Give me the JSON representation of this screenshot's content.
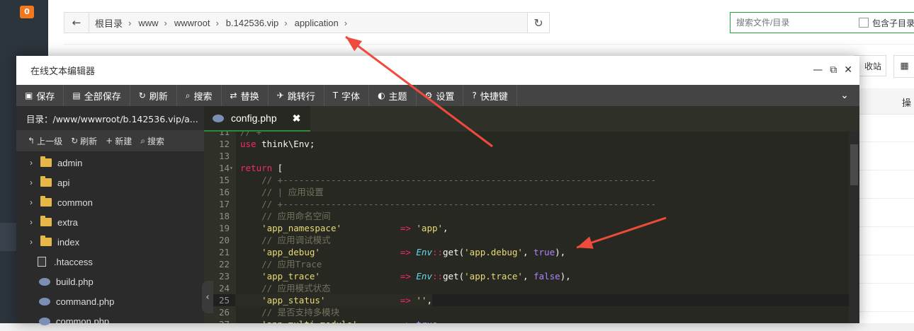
{
  "badge": {
    "count": "0"
  },
  "addressbar": {
    "crumbs": [
      "根目录",
      "www",
      "wwwroot",
      "b.142536.vip",
      "application"
    ]
  },
  "search": {
    "placeholder": "搜索文件/目录",
    "subdir_label": "包含子目录"
  },
  "right_partial": {
    "recycle_label": "收站",
    "table_head": "操"
  },
  "editor": {
    "title": "在线文本编辑器",
    "toolbar": [
      {
        "icon": "save-icon",
        "glyph": "▣",
        "label": "保存"
      },
      {
        "icon": "save-all-icon",
        "glyph": "▤",
        "label": "全部保存"
      },
      {
        "icon": "refresh-icon",
        "glyph": "↻",
        "label": "刷新"
      },
      {
        "icon": "search-icon",
        "glyph": "⌕",
        "label": "搜索"
      },
      {
        "icon": "replace-icon",
        "glyph": "⇄",
        "label": "替换"
      },
      {
        "icon": "goto-icon",
        "glyph": "✈",
        "label": "跳转行"
      },
      {
        "icon": "font-icon",
        "glyph": "T",
        "label": "字体"
      },
      {
        "icon": "theme-icon",
        "glyph": "◐",
        "label": "主题"
      },
      {
        "icon": "gear-icon",
        "glyph": "⚙",
        "label": "设置"
      },
      {
        "icon": "help-icon",
        "glyph": "?",
        "label": "快捷键"
      }
    ],
    "sidebar": {
      "dir_label": "目录：/www/wwwroot/b.142536.vip/a...",
      "tools": [
        {
          "icon": "up-icon",
          "glyph": "↰",
          "label": "上一级"
        },
        {
          "icon": "refresh-icon",
          "glyph": "↻",
          "label": "刷新"
        },
        {
          "icon": "plus-icon",
          "glyph": "+",
          "label": "新建"
        },
        {
          "icon": "search-icon",
          "glyph": "⌕",
          "label": "搜索"
        }
      ],
      "tree": [
        {
          "type": "folder",
          "name": "admin"
        },
        {
          "type": "folder",
          "name": "api"
        },
        {
          "type": "folder",
          "name": "common"
        },
        {
          "type": "folder",
          "name": "extra"
        },
        {
          "type": "folder",
          "name": "index"
        },
        {
          "type": "file",
          "name": ".htaccess"
        },
        {
          "type": "php",
          "name": "build.php"
        },
        {
          "type": "php",
          "name": "command.php"
        },
        {
          "type": "php",
          "name": "common.php"
        }
      ]
    },
    "tab": {
      "filename": "config.php"
    },
    "code_lines": [
      {
        "n": "11",
        "html": "<span class='c-comment'>// +</span>"
      },
      {
        "n": "12",
        "html": "<span class='c-kw'>use</span> think\\Env;"
      },
      {
        "n": "13",
        "html": ""
      },
      {
        "n": "14",
        "fold": true,
        "html": "<span class='c-kw'>return</span> ["
      },
      {
        "n": "15",
        "html": "    <span class='c-comment'>// +----------------------------------------------------------------------</span>"
      },
      {
        "n": "16",
        "html": "    <span class='c-comment'>// | 应用设置</span>"
      },
      {
        "n": "17",
        "html": "    <span class='c-comment'>// +----------------------------------------------------------------------</span>"
      },
      {
        "n": "18",
        "html": "    <span class='c-comment'>// 应用命名空间</span>"
      },
      {
        "n": "19",
        "html": "    <span class='c-str'>'app_namespace'</span>           <span class='c-arrow'>=></span> <span class='c-str'>'app'</span>,"
      },
      {
        "n": "20",
        "html": "    <span class='c-comment'>// 应用调试模式</span>"
      },
      {
        "n": "21",
        "html": "    <span class='c-str'>'app_debug'</span>               <span class='c-arrow'>=></span> <span class='c-cls'>Env</span><span class='c-arrow'>::</span>get(<span class='c-str'>'app.debug'</span>, <span class='c-bool'>true</span>),"
      },
      {
        "n": "22",
        "html": "    <span class='c-comment'>// 应用Trace</span>"
      },
      {
        "n": "23",
        "html": "    <span class='c-str'>'app_trace'</span>               <span class='c-arrow'>=></span> <span class='c-cls'>Env</span><span class='c-arrow'>::</span>get(<span class='c-str'>'app.trace'</span>, <span class='c-bool'>false</span>),"
      },
      {
        "n": "24",
        "html": "    <span class='c-comment'>// 应用模式状态</span>"
      },
      {
        "n": "25",
        "hl": true,
        "html": "    <span class='c-str'>'app_status'</span>              <span class='c-arrow'>=></span> <span class='c-str'>''</span>,"
      },
      {
        "n": "26",
        "html": "    <span class='c-comment'>// 是否支持多模块</span>"
      },
      {
        "n": "27",
        "html": "    <span class='c-str'>'app_multi_module'</span>        <span class='c-arrow'>=></span> <span class='c-bool'>true</span>,"
      }
    ]
  },
  "colors": {
    "arrow": "#f04a3c",
    "accent": "#20a53a",
    "badge": "#f0781e"
  }
}
